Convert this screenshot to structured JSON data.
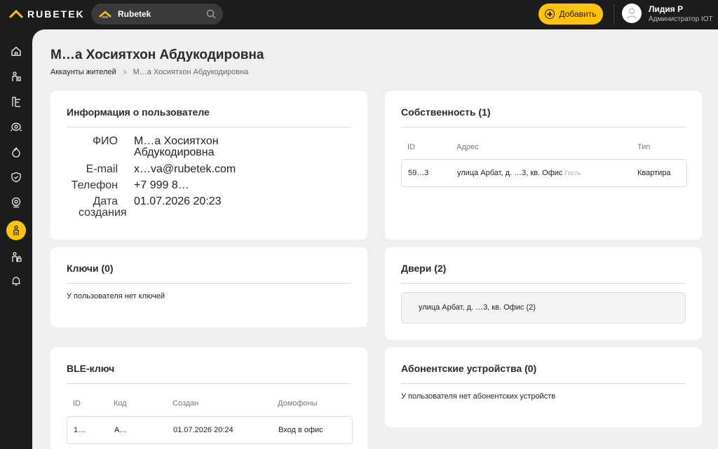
{
  "brand": {
    "logo_text": "RUBETEK",
    "accent": "#ffc20e"
  },
  "topbar": {
    "project_label": "Rubetek",
    "add_label": "Добавить",
    "user_name": "Лидия Р",
    "user_role": "Администратор IOT"
  },
  "sidebar": {
    "items": [
      {
        "icon": "home-icon"
      },
      {
        "icon": "residents-icon"
      },
      {
        "icon": "building-icon"
      },
      {
        "icon": "camera-icon"
      },
      {
        "icon": "fire-icon"
      },
      {
        "icon": "shield-icon"
      },
      {
        "icon": "webcam-icon"
      },
      {
        "icon": "user-accounts-icon",
        "active": true
      },
      {
        "icon": "user-lock-icon"
      },
      {
        "icon": "bell-icon"
      }
    ]
  },
  "page": {
    "title": "М…а Хосиятхон Абдукодировна",
    "breadcrumb_parent": "Аккаунты жителей",
    "breadcrumb_current": "М…а Хосиятхон Абдукодировна"
  },
  "user_info": {
    "title": "Информация о пользователе",
    "fio_label": "ФИО",
    "fio_value": "М…а Хосиятхон Абдукодировна",
    "email_label": "E-mail",
    "email_value": "x…va@rubetek.com",
    "phone_label": "Телефон",
    "phone_value": "+7 999 8…",
    "created_label": "Дата создания",
    "created_value": "01.07.2026 20:23"
  },
  "property": {
    "title": "Собственность (1)",
    "headers": {
      "id": "ID",
      "address": "Адрес",
      "type": "Тип"
    },
    "rows": [
      {
        "id": "59…3",
        "address": "улица Арбат, д. …3, кв. Офис",
        "badge": "Гость",
        "type": "Квартира"
      }
    ]
  },
  "keys": {
    "title": "Ключи (0)",
    "empty": "У пользователя нет ключей"
  },
  "doors": {
    "title": "Двери (2)",
    "items": [
      "улица Арбат, д. …3, кв. Офис (2)"
    ]
  },
  "ble": {
    "title": "BLE-ключ",
    "headers": {
      "id": "ID",
      "code": "Код",
      "created": "Создан",
      "intercoms": "Домофоны"
    },
    "rows": [
      {
        "id": "1…",
        "code": "A…",
        "created": "01.07.2026 20:24",
        "intercoms": "Вход в офис"
      }
    ]
  },
  "subscriber": {
    "title": "Абонентские устройства (0)",
    "empty": "У пользователя нет абонентских устройств"
  }
}
